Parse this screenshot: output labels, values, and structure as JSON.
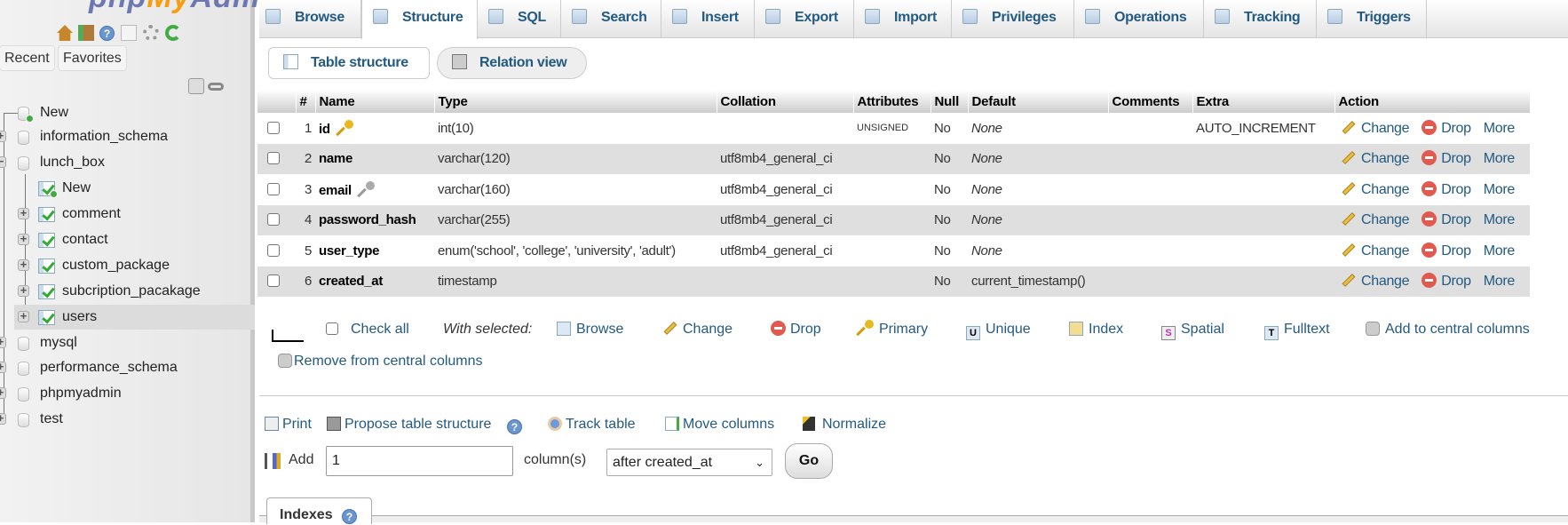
{
  "sidebar": {
    "logo": "phpMyAdmin",
    "recent_label": "Recent",
    "favorites_label": "Favorites",
    "tree": [
      {
        "label": "New",
        "level": 1,
        "icon": "new-database-icon",
        "expander": null
      },
      {
        "label": "information_schema",
        "level": 1,
        "icon": "database-icon",
        "expander": "+"
      },
      {
        "label": "lunch_box",
        "level": 1,
        "icon": "database-icon",
        "expander": "−"
      },
      {
        "label": "New",
        "level": 2,
        "icon": "new-table-icon",
        "expander": null
      },
      {
        "label": "comment",
        "level": 2,
        "icon": "table-icon",
        "expander": "+"
      },
      {
        "label": "contact",
        "level": 2,
        "icon": "table-icon",
        "expander": "+"
      },
      {
        "label": "custom_package",
        "level": 2,
        "icon": "table-icon",
        "expander": "+"
      },
      {
        "label": "subcription_pacakage",
        "level": 2,
        "icon": "table-icon",
        "expander": "+"
      },
      {
        "label": "users",
        "level": 2,
        "icon": "table-icon",
        "expander": "+",
        "selected": true
      },
      {
        "label": "mysql",
        "level": 1,
        "icon": "database-icon",
        "expander": "+"
      },
      {
        "label": "performance_schema",
        "level": 1,
        "icon": "database-icon",
        "expander": "+"
      },
      {
        "label": "phpmyadmin",
        "level": 1,
        "icon": "database-icon",
        "expander": "+"
      },
      {
        "label": "test",
        "level": 1,
        "icon": "database-icon",
        "expander": "+"
      }
    ]
  },
  "tabs": [
    {
      "label": "Browse"
    },
    {
      "label": "Structure",
      "active": true
    },
    {
      "label": "SQL"
    },
    {
      "label": "Search"
    },
    {
      "label": "Insert"
    },
    {
      "label": "Export"
    },
    {
      "label": "Import"
    },
    {
      "label": "Privileges"
    },
    {
      "label": "Operations"
    },
    {
      "label": "Tracking"
    },
    {
      "label": "Triggers"
    }
  ],
  "subtabs": {
    "table_structure": "Table structure",
    "relation_view": "Relation view"
  },
  "table": {
    "headers": [
      "",
      "#",
      "Name",
      "Type",
      "Collation",
      "Attributes",
      "Null",
      "Default",
      "Comments",
      "Extra",
      "Action"
    ],
    "rows": [
      {
        "num": "1",
        "name": "id",
        "key": "primary",
        "type": "int(10)",
        "collation": "",
        "attributes": "UNSIGNED",
        "null": "No",
        "default": "None",
        "default_italic": true,
        "comments": "",
        "extra": "AUTO_INCREMENT"
      },
      {
        "num": "2",
        "name": "name",
        "key": null,
        "type": "varchar(120)",
        "collation": "utf8mb4_general_ci",
        "attributes": "",
        "null": "No",
        "default": "None",
        "default_italic": true,
        "comments": "",
        "extra": ""
      },
      {
        "num": "3",
        "name": "email",
        "key": "unique",
        "type": "varchar(160)",
        "collation": "utf8mb4_general_ci",
        "attributes": "",
        "null": "No",
        "default": "None",
        "default_italic": true,
        "comments": "",
        "extra": ""
      },
      {
        "num": "4",
        "name": "password_hash",
        "key": null,
        "type": "varchar(255)",
        "collation": "utf8mb4_general_ci",
        "attributes": "",
        "null": "No",
        "default": "None",
        "default_italic": true,
        "comments": "",
        "extra": ""
      },
      {
        "num": "5",
        "name": "user_type",
        "key": null,
        "type": "enum('school', 'college', 'university', 'adult')",
        "collation": "utf8mb4_general_ci",
        "attributes": "",
        "null": "No",
        "default": "None",
        "default_italic": true,
        "comments": "",
        "extra": ""
      },
      {
        "num": "6",
        "name": "created_at",
        "key": null,
        "type": "timestamp",
        "collation": "",
        "attributes": "",
        "null": "No",
        "default": "current_timestamp()",
        "default_italic": false,
        "comments": "",
        "extra": ""
      }
    ],
    "actions": {
      "change": "Change",
      "drop": "Drop",
      "more": "More"
    }
  },
  "bulk": {
    "check_all": "Check all",
    "with_selected": "With selected:",
    "browse": "Browse",
    "change": "Change",
    "drop": "Drop",
    "primary": "Primary",
    "unique": "Unique",
    "index": "Index",
    "spatial": "Spatial",
    "fulltext": "Fulltext",
    "add_central": "Add to central columns",
    "remove_central": "Remove from central columns"
  },
  "tools": {
    "print": "Print",
    "propose": "Propose table structure",
    "track": "Track table",
    "move": "Move columns",
    "normalize": "Normalize"
  },
  "add_columns": {
    "label": "Add",
    "count": "1",
    "unit": "column(s)",
    "position": "after created_at",
    "go": "Go"
  },
  "indexes": {
    "label": "Indexes"
  }
}
